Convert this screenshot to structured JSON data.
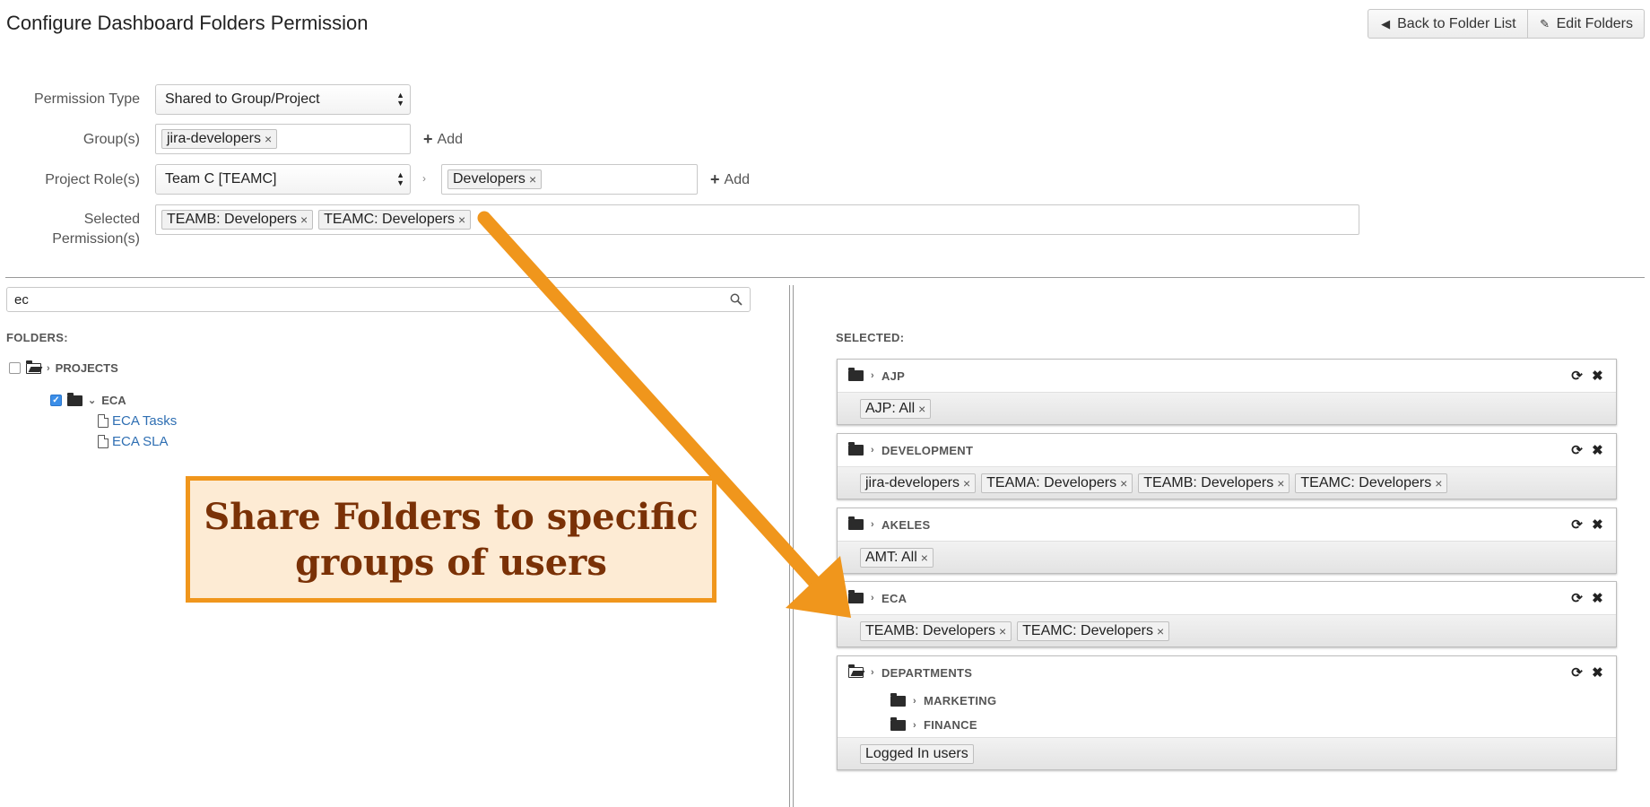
{
  "page_title": "Configure Dashboard Folders Permission",
  "top_buttons": {
    "back_label": "Back to Folder List",
    "edit_label": "Edit Folders"
  },
  "form": {
    "permission_type_label": "Permission Type",
    "permission_type_value": "Shared to Group/Project",
    "groups_label": "Group(s)",
    "groups_tokens": [
      "jira-developers"
    ],
    "add_label": "Add",
    "project_roles_label": "Project Role(s)",
    "project_value": "Team C [TEAMC]",
    "role_tokens": [
      "Developers"
    ],
    "selected_label_line1": "Selected",
    "selected_label_line2": "Permission(s)",
    "selected_tokens": [
      "TEAMB: Developers",
      "TEAMC: Developers"
    ]
  },
  "search": {
    "value": "ec"
  },
  "folders": {
    "label": "FOLDERS:",
    "root": "PROJECTS",
    "child": "ECA",
    "files": [
      "ECA Tasks",
      "ECA SLA"
    ]
  },
  "selected": {
    "label": "SELECTED:",
    "cards": [
      {
        "name": "AJP",
        "tokens": [
          "AJP: All"
        ]
      },
      {
        "name": "DEVELOPMENT",
        "tokens": [
          "jira-developers",
          "TEAMA: Developers",
          "TEAMB: Developers",
          "TEAMC: Developers"
        ]
      },
      {
        "name": "AKELES",
        "tokens": [
          "AMT: All"
        ]
      },
      {
        "name": "ECA",
        "tokens": [
          "TEAMB: Developers",
          "TEAMC: Developers"
        ]
      },
      {
        "name": "DEPARTMENTS",
        "subfolders": [
          "MARKETING",
          "FINANCE"
        ],
        "tokens": [
          "Logged In users"
        ]
      }
    ]
  },
  "callout": {
    "line1": "Share Folders to specific",
    "line2": "groups of users"
  },
  "colors": {
    "accent_orange": "#f0961c",
    "callout_bg": "#fdebd4",
    "callout_text": "#7a3106",
    "link_blue": "#2f6fb3",
    "checkbox_blue": "#3b8ee8"
  }
}
